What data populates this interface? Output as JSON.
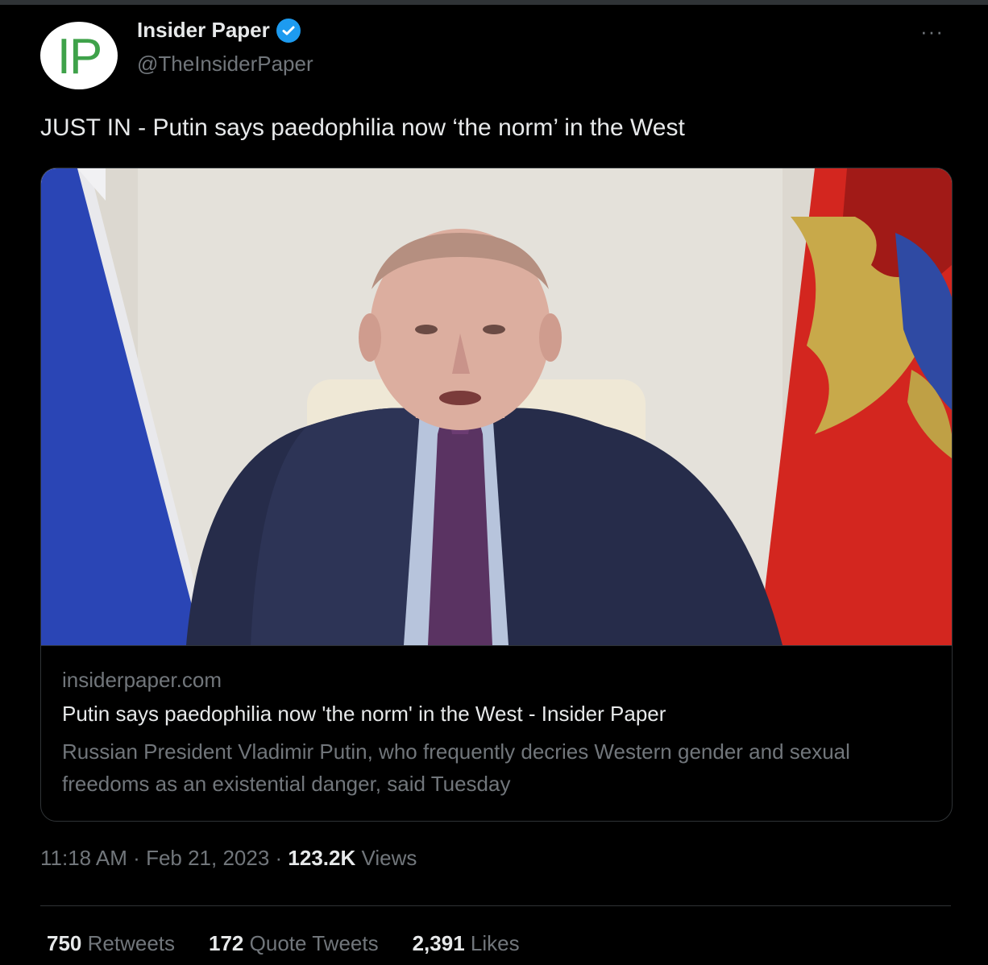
{
  "tweet": {
    "author": {
      "display_name": "Insider Paper",
      "handle": "@TheInsiderPaper",
      "avatar_text": "IP",
      "verified": true
    },
    "more_label": "···",
    "text": "JUST IN - Putin says paedophilia now ‘the norm’ in the West",
    "card": {
      "domain": "insiderpaper.com",
      "title": "Putin says paedophilia now 'the norm' in the West - Insider Paper",
      "description": "Russian President Vladimir Putin, who frequently decries Western gender and sexual freedoms as an existential danger, said Tuesday"
    },
    "meta": {
      "time": "11:18 AM",
      "date": "Feb 21, 2023",
      "views_count": "123.2K",
      "views_label": "Views"
    },
    "stats": {
      "retweets_count": "750",
      "retweets_label": "Retweets",
      "quotes_count": "172",
      "quotes_label": "Quote Tweets",
      "likes_count": "2,391",
      "likes_label": "Likes"
    }
  },
  "colors": {
    "background": "#000000",
    "text_primary": "#e7e9ea",
    "text_secondary": "#71767b",
    "verified": "#1d9bf0",
    "divider": "#2f3336",
    "logo_green": "#3fa24a"
  },
  "icons": {
    "verified": "verified-badge-icon",
    "more": "more-icon"
  }
}
